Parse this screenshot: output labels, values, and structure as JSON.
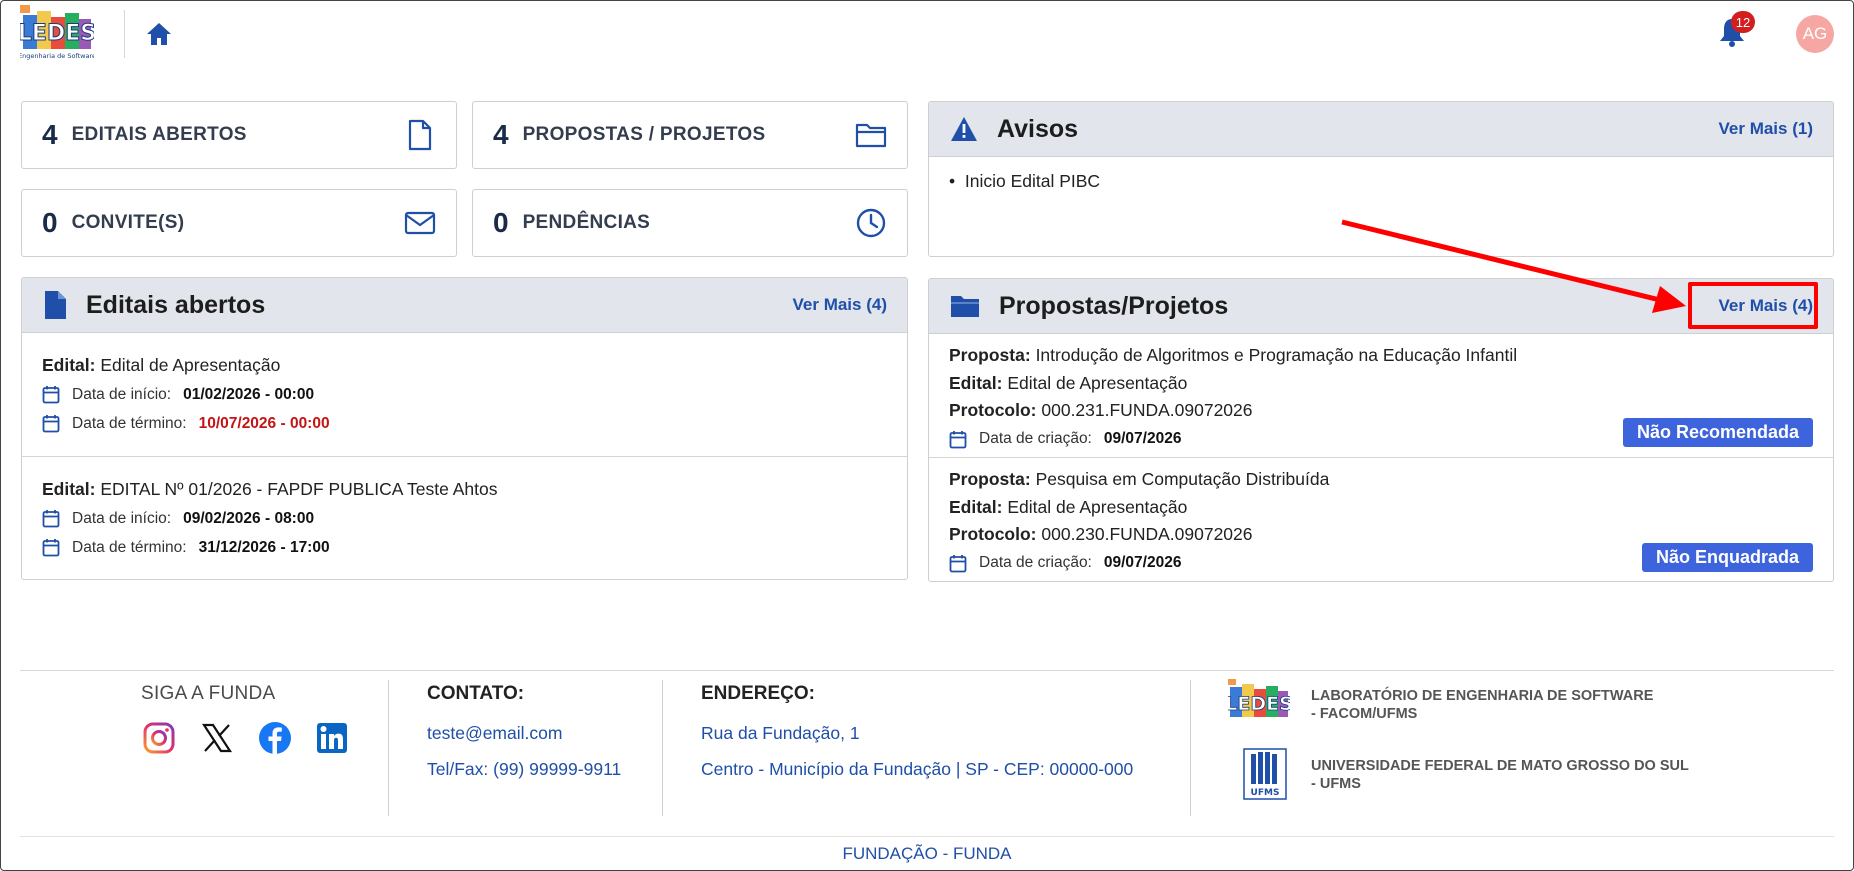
{
  "header": {
    "logo_text": "LEDES",
    "logo_subtitle": "Engenharia de Software",
    "notifications_count": "12",
    "avatar_initials": "AG"
  },
  "stats": [
    {
      "count": "4",
      "label": "EDITAIS ABERTOS",
      "icon": "document-icon"
    },
    {
      "count": "4",
      "label": "PROPOSTAS / PROJETOS",
      "icon": "folder-icon"
    },
    {
      "count": "0",
      "label": "CONVITE(S)",
      "icon": "envelope-icon"
    },
    {
      "count": "0",
      "label": "PENDÊNCIAS",
      "icon": "clock-icon"
    }
  ],
  "avisos": {
    "title": "Avisos",
    "ver_mais": "Ver Mais (1)",
    "items": [
      "Inicio Edital PIBC"
    ]
  },
  "editais": {
    "title": "Editais abertos",
    "ver_mais": "Ver Mais (4)",
    "edital_label": "Edital:",
    "start_label": "Data de início:",
    "end_label": "Data de término:",
    "items": [
      {
        "name": "Edital de Apresentação",
        "start": "01/02/2026 - 00:00",
        "end": "10/07/2026 - 00:00"
      },
      {
        "name": "EDITAL Nº 01/2026 - FAPDF PUBLICA Teste Ahtos",
        "start": "09/02/2026 - 08:00",
        "end": "31/12/2026 - 17:00"
      }
    ]
  },
  "propostas": {
    "title": "Propostas/Projetos",
    "ver_mais": "Ver Mais (4)",
    "proposta_label": "Proposta:",
    "edital_label": "Edital:",
    "protocolo_label": "Protocolo:",
    "created_label": "Data de criação:",
    "items": [
      {
        "proposta": "Introdução de Algoritmos e Programação na Educação Infantil",
        "edital": "Edital de Apresentação",
        "protocolo": "000.231.FUNDA.09072026",
        "created": "09/07/2026",
        "status": "Não Recomendada"
      },
      {
        "proposta": "Pesquisa em Computação Distribuída",
        "edital": "Edital de Apresentação",
        "protocolo": "000.230.FUNDA.09072026",
        "created": "09/07/2026",
        "status": "Não Enquadrada"
      }
    ]
  },
  "footer": {
    "social_title": "SIGA A FUNDA",
    "contact_title": "CONTATO:",
    "email": "teste@email.com",
    "phone": "Tel/Fax: (99) 99999-9911",
    "address_title": "ENDEREÇO:",
    "address_line1": "Rua da Fundação, 1",
    "address_line2": "Centro - Município da Fundação | SP - CEP: 00000-000",
    "org1_line1": "LABORATÓRIO DE ENGENHARIA DE SOFTWARE",
    "org1_line2": "- FACOM/UFMS",
    "org2_line1": "UNIVERSIDADE FEDERAL DE MATO GROSSO DO SUL",
    "org2_line2": "- UFMS",
    "org2_logo_text": "UFMS",
    "bottom": "FUNDAÇÃO - FUNDA"
  },
  "colors": {
    "accent": "#1f4fa8",
    "badge": "#3d63dd",
    "alert": "#d21e1e",
    "highlight": "#ff0000"
  }
}
